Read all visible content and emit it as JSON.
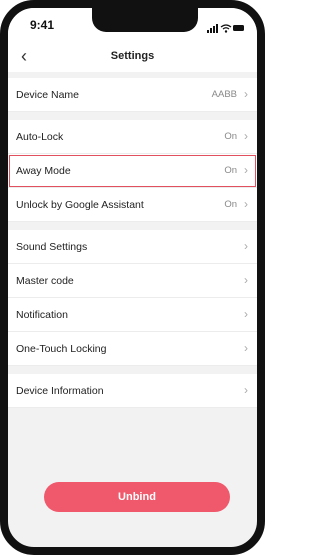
{
  "status_bar": {
    "time": "9:41",
    "icons": [
      "signal-icon",
      "wifi-icon",
      "battery-icon"
    ]
  },
  "nav": {
    "back_icon": "chevron-left-icon",
    "title": "Settings"
  },
  "settings": {
    "device_name": {
      "label": "Device Name",
      "value": "AABB"
    },
    "auto_lock": {
      "label": "Auto-Lock",
      "value": "On"
    },
    "away_mode": {
      "label": "Away Mode",
      "value": "On",
      "highlighted": true
    },
    "google_assistant": {
      "label": "Unlock by Google Assistant",
      "value": "On"
    },
    "sound_settings": {
      "label": "Sound Settings"
    },
    "master_code": {
      "label": "Master code"
    },
    "notification": {
      "label": "Notification"
    },
    "one_touch_locking": {
      "label": "One-Touch Locking"
    },
    "device_information": {
      "label": "Device Information"
    }
  },
  "unbind_button": {
    "label": "Unbind"
  },
  "colors": {
    "accent": "#f0596c",
    "highlight": "#e0505e",
    "background": "#f2f2f2"
  }
}
